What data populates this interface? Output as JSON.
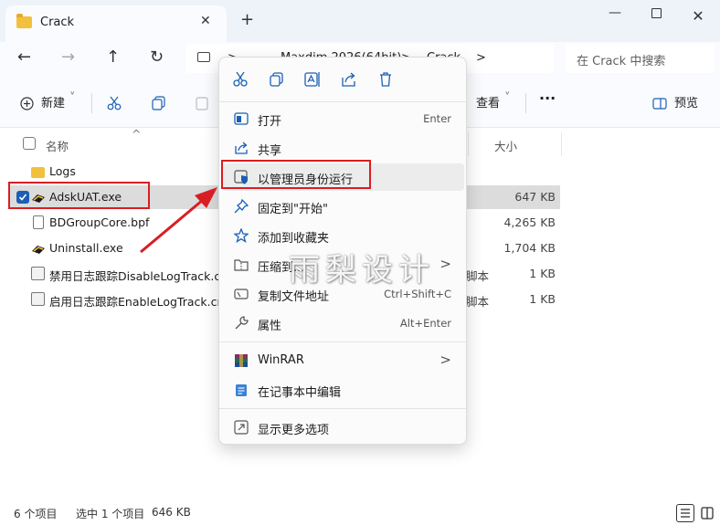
{
  "window": {
    "tab_title": "Crack",
    "tab_close": "✕",
    "new_tab": "+",
    "min": "—",
    "close": "✕"
  },
  "nav": {
    "back": "←",
    "forward": "→",
    "up": "↑",
    "refresh": "↻",
    "breadcrumb": [
      ">",
      "Maxdim 2026(64bit)",
      ">",
      "Crack",
      ">"
    ],
    "search_placeholder": "在 Crack 中搜索"
  },
  "toolbar": {
    "new_label": "新建",
    "new_dropdown": "˅",
    "view_label": "查看",
    "view_dropdown": "˅",
    "more": "···",
    "preview_label": "预览"
  },
  "columns": {
    "name": "名称",
    "size": "大小",
    "sort_indicator": "^"
  },
  "files": [
    {
      "name": "Logs",
      "size": "",
      "type": "",
      "icon": "folder-icon",
      "selected": false
    },
    {
      "name": "AdskUAT.exe",
      "size": "647 KB",
      "type": "",
      "icon": "exe-icon",
      "selected": true
    },
    {
      "name": "BDGroupCore.bpf",
      "size": "4,265 KB",
      "type": "",
      "icon": "document-icon",
      "selected": false
    },
    {
      "name": "Uninstall.exe",
      "size": "1,704 KB",
      "type": "",
      "icon": "exe-icon",
      "selected": false
    },
    {
      "name": "禁用日志跟踪DisableLogTrack.cmd",
      "size": "1 KB",
      "type": "脚本",
      "icon": "batch-file-icon",
      "selected": false
    },
    {
      "name": "启用日志跟踪EnableLogTrack.cmd",
      "size": "1 KB",
      "type": "脚本",
      "icon": "batch-file-icon",
      "selected": false
    }
  ],
  "status": {
    "item_count": "6 个项目",
    "selection": "选中 1 个项目",
    "selection_size": "646 KB"
  },
  "context_menu": {
    "items": [
      {
        "label": "打开",
        "shortcut": "Enter",
        "icon": "open-icon"
      },
      {
        "label": "共享",
        "shortcut": "",
        "icon": "share-icon"
      },
      {
        "label": "以管理员身份运行",
        "shortcut": "",
        "icon": "admin-shield-icon"
      },
      {
        "label": "固定到\"开始\"",
        "shortcut": "",
        "icon": "pin-icon"
      },
      {
        "label": "添加到收藏夹",
        "shortcut": "",
        "icon": "star-icon"
      },
      {
        "label": "压缩到...",
        "shortcut": "",
        "icon": "zip-icon",
        "submenu": true
      },
      {
        "label": "复制文件地址",
        "shortcut": "Ctrl+Shift+C",
        "icon": "copy-path-icon"
      },
      {
        "label": "属性",
        "shortcut": "Alt+Enter",
        "icon": "properties-icon"
      },
      {
        "label": "WinRAR",
        "shortcut": "",
        "icon": "winrar-icon",
        "submenu": true
      },
      {
        "label": "在记事本中编辑",
        "shortcut": "",
        "icon": "notepad-icon"
      },
      {
        "label": "显示更多选项",
        "shortcut": "",
        "icon": "more-options-icon"
      }
    ],
    "submenu_arrow": ">"
  },
  "watermark": "雨梨设计",
  "colors": {
    "highlight_red": "#d81e23",
    "accent_blue": "#1a5fb4",
    "folder_yellow": "#f3c03c"
  }
}
